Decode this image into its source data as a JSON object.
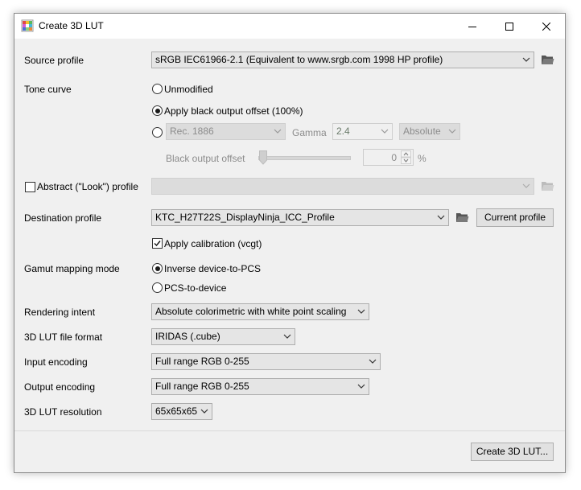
{
  "window": {
    "title": "Create 3D LUT"
  },
  "source_profile": {
    "label": "Source profile",
    "value": "sRGB IEC61966-2.1 (Equivalent to www.srgb.com 1998 HP profile)"
  },
  "tone_curve": {
    "label": "Tone curve",
    "options": [
      "Unmodified",
      "Apply black output offset (100%)"
    ],
    "selected": "Apply black output offset (100%)",
    "custom": {
      "curve": "Rec. 1886",
      "gamma_label": "Gamma",
      "gamma": "2.4",
      "gamma_type": "Absolute",
      "black_offset_label": "Black output offset",
      "black_offset_value": "0",
      "black_offset_unit": "%"
    }
  },
  "abstract_profile": {
    "label": "Abstract (\"Look\") profile",
    "checked": false,
    "value": ""
  },
  "destination_profile": {
    "label": "Destination profile",
    "value": "KTC_H27T22S_DisplayNinja_ICC_Profile",
    "current_profile_button": "Current profile",
    "apply_calibration_label": "Apply calibration (vcgt)",
    "apply_calibration_checked": true
  },
  "gamut_mapping": {
    "label": "Gamut mapping mode",
    "options": [
      "Inverse device-to-PCS",
      "PCS-to-device"
    ],
    "selected": "Inverse device-to-PCS"
  },
  "rendering_intent": {
    "label": "Rendering intent",
    "value": "Absolute colorimetric with white point scaling"
  },
  "lut_format": {
    "label": "3D LUT file format",
    "value": "IRIDAS (.cube)"
  },
  "input_encoding": {
    "label": "Input encoding",
    "value": "Full range RGB 0-255"
  },
  "output_encoding": {
    "label": "Output encoding",
    "value": "Full range RGB 0-255"
  },
  "lut_resolution": {
    "label": "3D LUT resolution",
    "value": "65x65x65"
  },
  "footer": {
    "create_button": "Create 3D LUT..."
  },
  "colors": {
    "window_bg": "#f0f0f0",
    "titlebar_bg": "#ffffff",
    "folder": "#555555",
    "disabled_text": "#8c8c8c"
  }
}
